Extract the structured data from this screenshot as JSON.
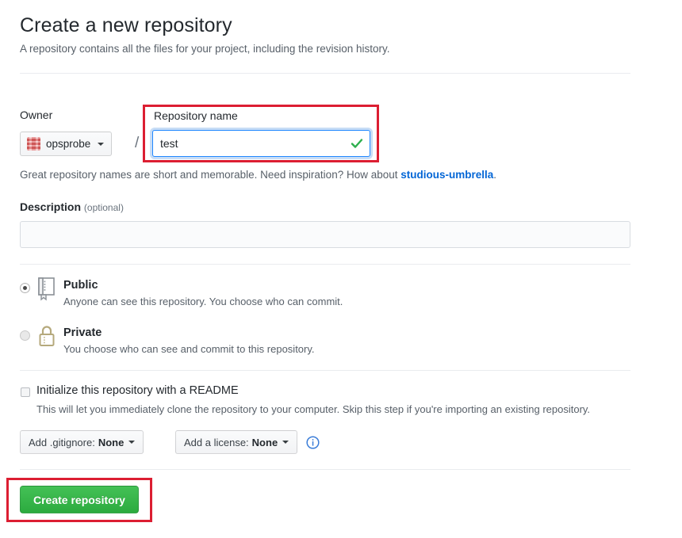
{
  "header": {
    "title": "Create a new repository",
    "subtitle": "A repository contains all the files for your project, including the revision history."
  },
  "owner": {
    "label": "Owner",
    "name": "opsprobe",
    "avatar_icon": "identicon-avatar",
    "avatar_color": "#e89a9a",
    "caret_icon": "chevron-down-icon",
    "separator": "/"
  },
  "repository_name": {
    "label": "Repository name",
    "value": "test",
    "placeholder": "",
    "valid_icon": "checkmark-icon",
    "valid_color": "#28a745",
    "focus_color": "#2188ff",
    "annotation_color": "#dc1e32"
  },
  "repo_hint": {
    "text_before": "Great repository names are short and memorable. Need inspiration? How about ",
    "suggestion": "studious-umbrella",
    "text_after": ".",
    "link_color": "#0366d6"
  },
  "description": {
    "label": "Description",
    "optional": "(optional)",
    "value": "",
    "placeholder": ""
  },
  "visibility": {
    "options": [
      {
        "id": "public",
        "title": "Public",
        "description": "Anyone can see this repository. You choose who can commit.",
        "icon": "repo-book-icon",
        "icon_color": "#6a737d",
        "selected": true
      },
      {
        "id": "private",
        "title": "Private",
        "description": "You choose who can see and commit to this repository.",
        "icon": "lock-icon",
        "icon_color": "#b5a97c",
        "selected": false
      }
    ]
  },
  "readme": {
    "label": "Initialize this repository with a README",
    "description": "This will let you immediately clone the repository to your computer. Skip this step if you're importing an existing repository.",
    "checked": false
  },
  "gitignore": {
    "prefix": "Add .gitignore:",
    "value": "None",
    "caret_icon": "chevron-down-icon"
  },
  "license": {
    "prefix": "Add a license:",
    "value": "None",
    "caret_icon": "chevron-down-icon",
    "info_icon": "info-circle-icon",
    "info_color": "#0366d6"
  },
  "submit": {
    "label": "Create repository",
    "color": "#2cab3f",
    "annotation_color": "#dc1e32"
  }
}
